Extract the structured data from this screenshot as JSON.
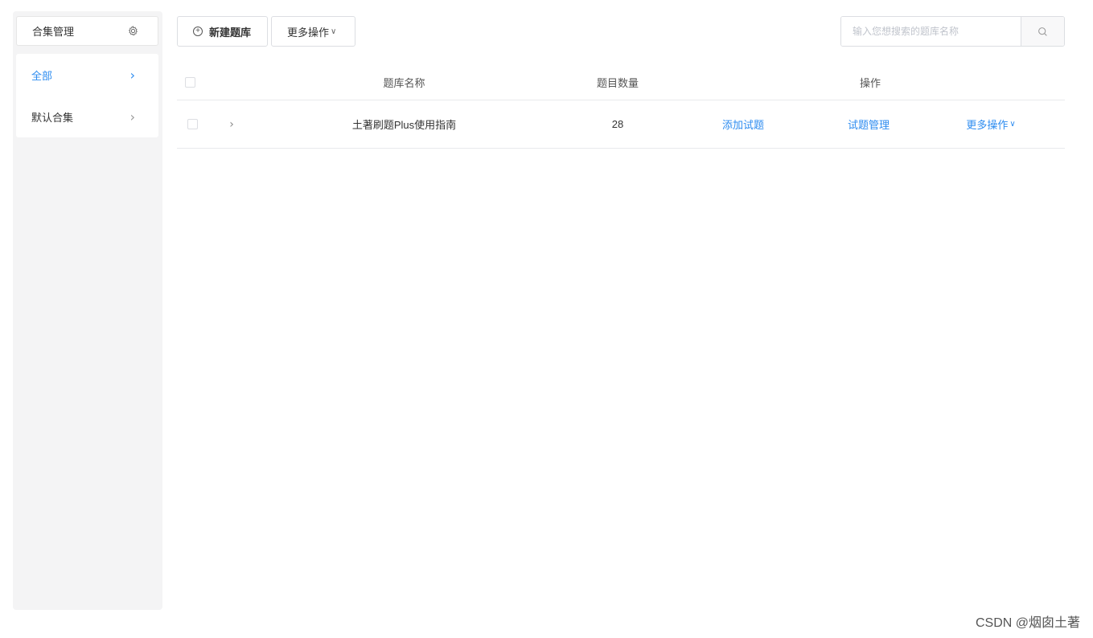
{
  "sidebar": {
    "header_label": "合集管理",
    "header_icon": "gear-icon",
    "items": [
      {
        "label": "全部",
        "active": true
      },
      {
        "label": "默认合集",
        "active": false
      }
    ]
  },
  "toolbar": {
    "new_label": "新建题库",
    "more_label": "更多操作",
    "caret": "∨"
  },
  "search": {
    "placeholder": "输入您想搜索的题库名称"
  },
  "table": {
    "headers": {
      "name": "题库名称",
      "count": "题目数量",
      "actions": "操作"
    },
    "rows": [
      {
        "name": "土著刷题Plus使用指南",
        "count": "28",
        "action_add": "添加试题",
        "action_manage": "试题管理",
        "action_more": "更多操作"
      }
    ]
  },
  "watermark": "CSDN @烟囱土著",
  "colors": {
    "accent": "#2d8cf0",
    "sidebar_bg": "#f4f4f5",
    "border": "#dcdee2"
  }
}
